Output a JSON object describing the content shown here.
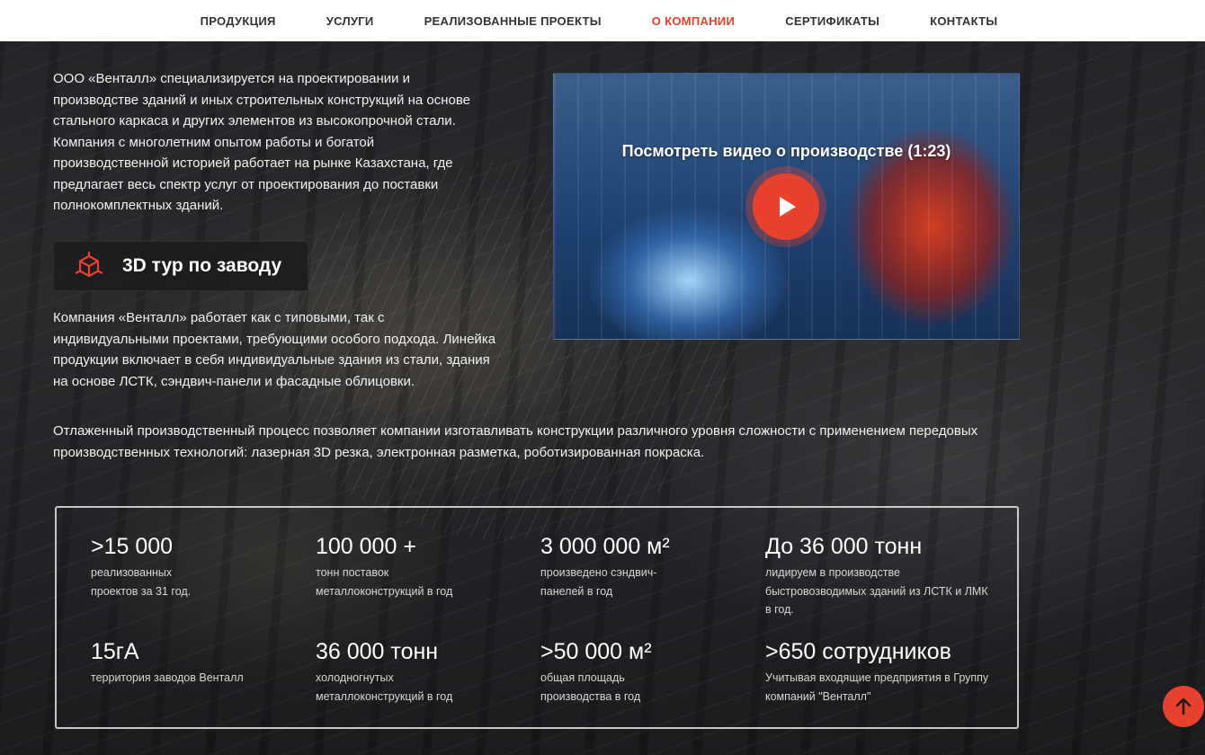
{
  "nav": {
    "items": [
      {
        "label": "ПРОДУКЦИЯ",
        "active": false
      },
      {
        "label": "УСЛУГИ",
        "active": false
      },
      {
        "label": "РЕАЛИЗОВАННЫЕ ПРОЕКТЫ",
        "active": false
      },
      {
        "label": "О КОМПАНИИ",
        "active": true
      },
      {
        "label": "СЕРТИФИКАТЫ",
        "active": false
      },
      {
        "label": "КОНТАКТЫ",
        "active": false
      }
    ],
    "active_color": "#e8402c"
  },
  "intro": "ООО «Венталл» специализируется на проектировании и производстве зданий и иных строительных конструкций на основе стального каркаса и других элементов из высокопрочной стали. Компания с многолетним опытом работы и богатой производственной историей работает на рынке Казахстана, где предлагает весь спектр услуг от проектирования до поставки полнокомплектных зданий.",
  "tour": {
    "icon": "cube-3d-icon",
    "label": "3D тур по заводу"
  },
  "paragraph2": "Компания «Венталл» работает как с типовыми, так с индивидуальными проектами, требующими особого подхода. Линейка продукции включает в себя индивидуальные здания из стали, здания на основе ЛСТК, сэндвич-панели и фасадные облицовки.",
  "paragraph3": "Отлаженный производственный процесс позволяет компании изготавливать конструкции различного уровня сложности с применением передовых производственных технологий: лазерная 3D резка, электронная разметка, роботизированная покраска.",
  "video": {
    "title": "Посмотреть видео о производстве (1:23)",
    "play_icon": "play-icon",
    "accent": "#e8412d"
  },
  "stats": [
    {
      "value": ">15 000",
      "desc": "реализованных проектов за 31 год."
    },
    {
      "value": "100 000 +",
      "desc": "тонн поставок металлоконструкций в год"
    },
    {
      "value": "3 000 000 м²",
      "desc": "произведено сэндвич-панелей в год"
    },
    {
      "value": "До 36 000 тонн",
      "desc": "лидируем в производстве быстровозводимых зданий из ЛСТК и ЛМК в год."
    },
    {
      "value": "15гА",
      "desc": "территория заводов Венталл"
    },
    {
      "value": "36 000 тонн",
      "desc": "холодногнутых металлоконструкций в год"
    },
    {
      "value": ">50 000 м²",
      "desc": "общая площадь производства в год"
    },
    {
      "value": ">650 сотрудников",
      "desc": "Учитывая входящие предприятия в Группу компаний \"Венталл\""
    }
  ],
  "scroll_top": {
    "icon": "arrow-up-icon",
    "color": "#e8412d"
  }
}
